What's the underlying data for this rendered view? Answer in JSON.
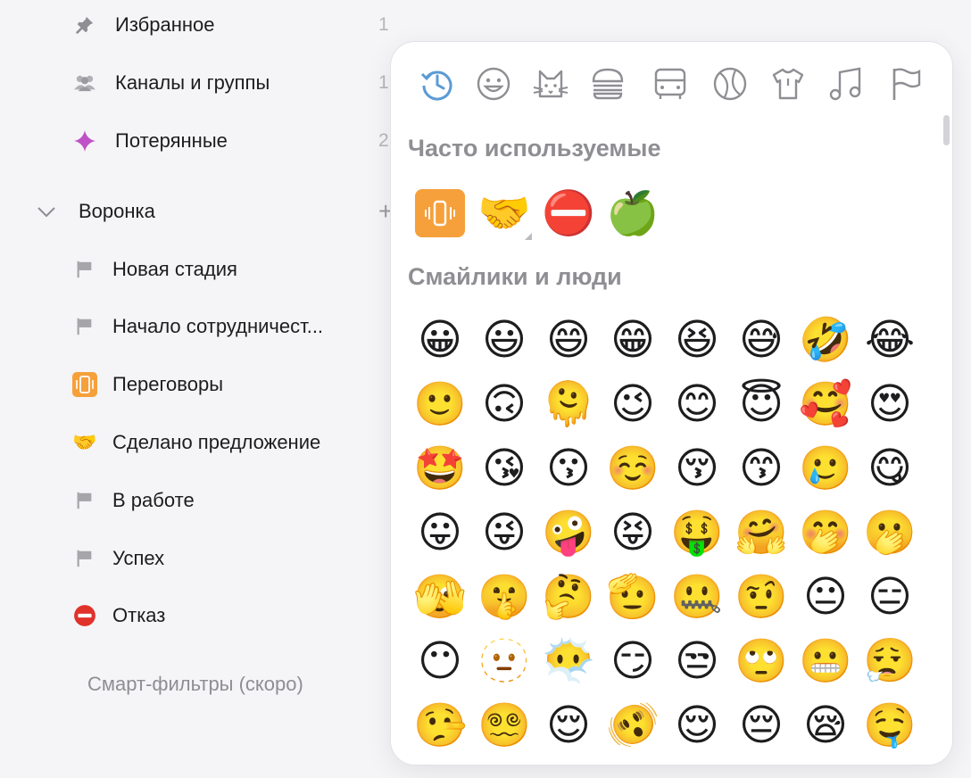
{
  "sidebar": {
    "top_items": [
      {
        "label": "Избранное",
        "count": "1",
        "icon": "pin-icon"
      },
      {
        "label": "Каналы и группы",
        "count": "1",
        "icon": "people-icon"
      },
      {
        "label": "Потерянные",
        "count": "2",
        "icon": "sparkle-icon"
      }
    ],
    "group": {
      "label": "Воронка",
      "expanded": true,
      "add_label": "+"
    },
    "stages": [
      {
        "label": "Новая стадия",
        "icon": "flag-icon"
      },
      {
        "label": "Начало сотрудничест...",
        "icon": "flag-icon"
      },
      {
        "label": "Переговоры",
        "icon": "vibration-mode-icon"
      },
      {
        "label": "Сделано предложение",
        "icon": "handshake-icon",
        "glyph": "🤝"
      },
      {
        "label": "В работе",
        "icon": "flag-icon"
      },
      {
        "label": "Успех",
        "icon": "flag-icon"
      },
      {
        "label": "Отказ",
        "icon": "no-entry-icon",
        "glyph": "⛔"
      }
    ],
    "smart_filters": "Смарт-фильтры (скоро)"
  },
  "picker": {
    "categories": [
      "recent-icon",
      "smileys-icon",
      "animals-icon",
      "food-icon",
      "travel-icon",
      "activity-icon",
      "objects-icon",
      "symbols-icon",
      "flags-icon"
    ],
    "active_category": "recent-icon",
    "accent": "#5b9bd5",
    "frequent_title": "Часто используемые",
    "frequent": [
      "📳",
      "🤝",
      "⛔",
      "🍏"
    ],
    "smileys_title": "Смайлики и люди",
    "smileys": [
      [
        "😀",
        "😃",
        "😄",
        "😁",
        "😆",
        "😅",
        "🤣",
        "😂"
      ],
      [
        "🙂",
        "🙃",
        "🫠",
        "😉",
        "😊",
        "😇",
        "🥰",
        "😍"
      ],
      [
        "🤩",
        "😘",
        "😗",
        "☺️",
        "😚",
        "😙",
        "🥲",
        "😋"
      ],
      [
        "😛",
        "😜",
        "🤪",
        "😝",
        "🤑",
        "🤗",
        "🤭",
        "🫢"
      ],
      [
        "🫣",
        "🤫",
        "🤔",
        "🫡",
        "🤐",
        "🤨",
        "😐",
        "😑"
      ],
      [
        "😶",
        "🫥",
        "😶‍🌫️",
        "😏",
        "😒",
        "🙄",
        "😬",
        "😮‍💨"
      ],
      [
        "🤥",
        "😵‍💫",
        "😌",
        "🫨",
        "😌",
        "😔",
        "😪",
        "🤤"
      ]
    ]
  }
}
